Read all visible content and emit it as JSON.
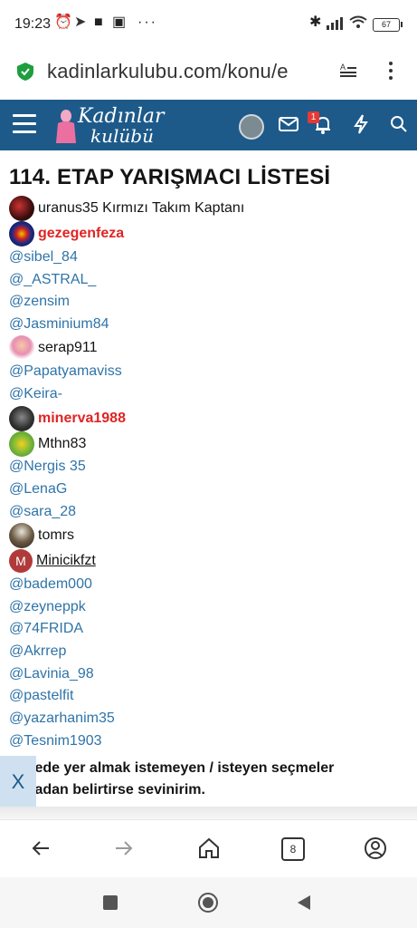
{
  "status_bar": {
    "time": "19:23",
    "battery": "67"
  },
  "browser": {
    "url": "kadinlarkulubu.com/konu/e"
  },
  "site": {
    "logo_line1": "Kadınlar",
    "logo_line2": "kulübü",
    "notification_count": "1"
  },
  "post": {
    "title": "114. ETAP YARIŞMACI LİSTESİ",
    "items": [
      {
        "type": "avatar",
        "text": "uranus35 Kırmızı Takım Kaptanı"
      },
      {
        "type": "avatar-red",
        "text": "gezegenfeza"
      },
      {
        "type": "mention",
        "text": "@sibel_84"
      },
      {
        "type": "mention",
        "text": "@_ASTRAL_"
      },
      {
        "type": "mention",
        "text": "@zensim"
      },
      {
        "type": "mention",
        "text": "@Jasminium84"
      },
      {
        "type": "avatar",
        "text": "serap911"
      },
      {
        "type": "mention",
        "text": "@Papatyamaviss"
      },
      {
        "type": "mention",
        "text": "@Keira-"
      },
      {
        "type": "avatar-red",
        "text": "minerva1988"
      },
      {
        "type": "avatar",
        "text": "Mthn83"
      },
      {
        "type": "mention",
        "text": "@Nergis 35"
      },
      {
        "type": "mention",
        "text": "@LenaG"
      },
      {
        "type": "mention",
        "text": "@sara_28"
      },
      {
        "type": "avatar",
        "text": "tomrs"
      },
      {
        "type": "avatar-letter",
        "letter": "M",
        "text": "Minicikfzt"
      },
      {
        "type": "mention",
        "text": "@badem000"
      },
      {
        "type": "mention",
        "text": "@zeyneppk"
      },
      {
        "type": "mention",
        "text": "@74FRIDA"
      },
      {
        "type": "mention",
        "text": "@Akrrep"
      },
      {
        "type": "mention",
        "text": "@Lavinia_98"
      },
      {
        "type": "mention",
        "text": "@pastelfit"
      },
      {
        "type": "mention",
        "text": "@yazarhanim35"
      },
      {
        "type": "mention",
        "text": "@Tesnim1903"
      }
    ],
    "footer_line1": "Listede yer almak istemeyen / isteyen seçmeler",
    "footer_line2": "olmadan belirtirse sevinirim."
  },
  "close_tab_label": "X",
  "toolbar": {
    "tabs_count": "8"
  }
}
